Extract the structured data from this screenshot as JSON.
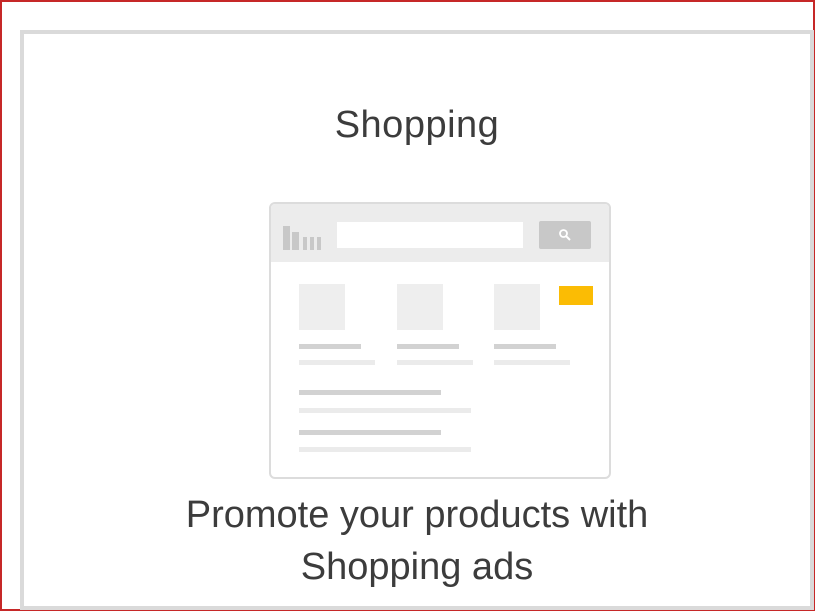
{
  "card": {
    "title": "Shopping",
    "description_line1": "Promote your products with",
    "description_line2": "Shopping ads"
  },
  "illustration": {
    "icon": "shopping-results-page-icon",
    "badge_color": "#fbbc04",
    "search_icon": "magnifier-icon"
  },
  "colors": {
    "selection_outline": "#c62828",
    "card_border": "#dadada",
    "text": "#3c3c3c"
  }
}
